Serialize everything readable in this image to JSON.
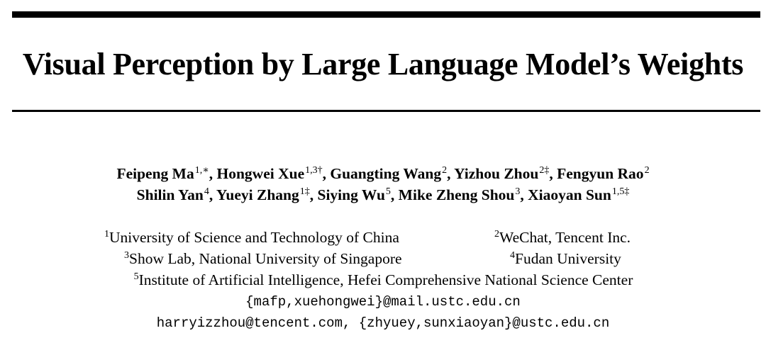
{
  "paper": {
    "title": "Visual Perception by Large Language Model’s Weights",
    "authors": [
      {
        "name": "Feipeng Ma",
        "marks": "1,∗"
      },
      {
        "name": "Hongwei Xue",
        "marks": "1,3†"
      },
      {
        "name": "Guangting Wang",
        "marks": "2"
      },
      {
        "name": "Yizhou Zhou",
        "marks": "2‡"
      },
      {
        "name": "Fengyun Rao",
        "marks": "2"
      },
      {
        "name": "Shilin Yan",
        "marks": "4"
      },
      {
        "name": "Yueyi Zhang",
        "marks": "1‡"
      },
      {
        "name": "Siying Wu",
        "marks": "5"
      },
      {
        "name": "Mike Zheng Shou",
        "marks": "3"
      },
      {
        "name": "Xiaoyan Sun",
        "marks": "1,5‡"
      }
    ],
    "affiliations": [
      {
        "mark": "1",
        "text": "University of Science and Technology of China"
      },
      {
        "mark": "2",
        "text": "WeChat, Tencent Inc."
      },
      {
        "mark": "3",
        "text": "Show Lab, National University of Singapore"
      },
      {
        "mark": "4",
        "text": "Fudan University"
      },
      {
        "mark": "5",
        "text": "Institute of Artificial Intelligence, Hefei Comprehensive National Science Center"
      }
    ],
    "emails": [
      "{mafp,xuehongwei}@mail.ustc.edu.cn",
      "harryizzhou@tencent.com, {zhyuey,sunxiaoyan}@ustc.edu.cn"
    ]
  }
}
